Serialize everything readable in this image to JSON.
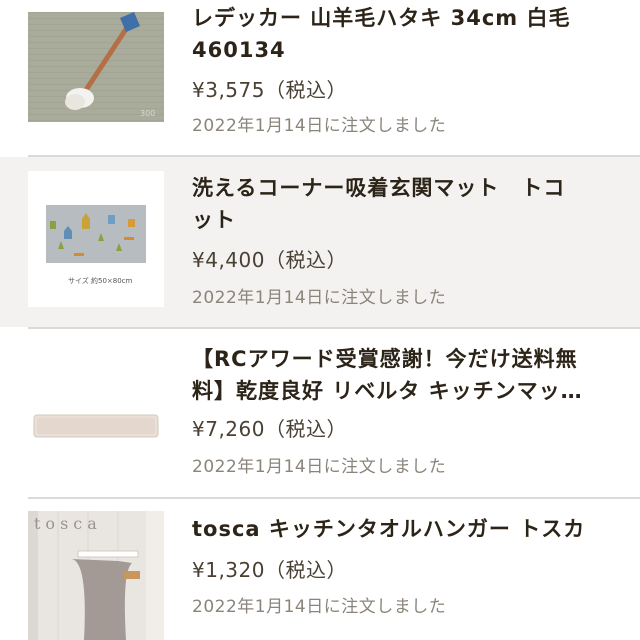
{
  "orders": [
    {
      "title_line1": "レデッカー 山羊毛ハタキ 34cm 白毛",
      "title_line2": "460134",
      "price": "¥3,575（税込）",
      "date": "2022年1月14日に注文しました",
      "thumb_caption": "300"
    },
    {
      "title_line1": "洗えるコーナー吸着玄関マット　トコ",
      "title_line2": "ット",
      "price": "¥4,400（税込）",
      "date": "2022年1月14日に注文しました",
      "thumb_caption": "サイズ 約50×80cm"
    },
    {
      "title_line1": "【RCアワード受賞感謝！今だけ送料無",
      "title_line2": "料】乾度良好 リベルタ キッチンマッ…",
      "price": "¥7,260（税込）",
      "date": "2022年1月14日に注文しました",
      "thumb_caption": ""
    },
    {
      "title_line1": "tosca キッチンタオルハンガー トスカ",
      "title_line2": "",
      "price": "¥1,320（税込）",
      "date": "2022年1月14日に注文しました",
      "thumb_caption": "tosca"
    }
  ]
}
